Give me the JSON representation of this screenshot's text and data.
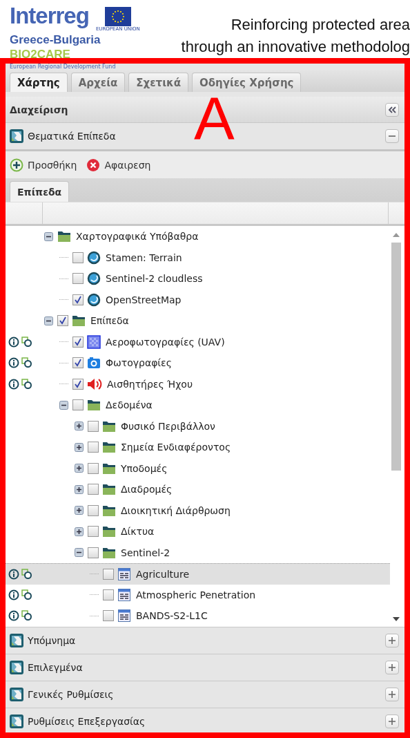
{
  "header": {
    "logo_text": "Interreg",
    "flag_caption": "EUROPEAN UNION",
    "region": "Greece-Bulgaria",
    "project": "BIO2CARE",
    "fund": "European Regional Development Fund",
    "title_lines": [
      "Reinforcing protected area",
      "through an innovative methodolog"
    ]
  },
  "annotation": {
    "label": "A"
  },
  "tabs": [
    {
      "label": "Χάρτης",
      "selected": true
    },
    {
      "label": "Αρχεία",
      "selected": false
    },
    {
      "label": "Σχετικά",
      "selected": false
    },
    {
      "label": "Οδηγίες Χρήσης",
      "selected": false
    }
  ],
  "panel": {
    "title": "Διαχείριση"
  },
  "sections": [
    {
      "title": "Θεματικά Επίπεδα",
      "expanded": true
    },
    {
      "title": "Υπόμνημα",
      "expanded": false
    },
    {
      "title": "Επιλεγμένα",
      "expanded": false
    },
    {
      "title": "Γενικές Ρυθμίσεις",
      "expanded": false
    },
    {
      "title": "Ρυθμίσεις Επεξεργασίας",
      "expanded": false
    }
  ],
  "toolbar": [
    {
      "kind": "add",
      "label": "Προσθήκη"
    },
    {
      "kind": "remove",
      "label": "Αφαιρεση"
    }
  ],
  "subtabs": [
    {
      "label": "Επίπεδα",
      "selected": true
    }
  ],
  "tree": [
    {
      "kind": "folder",
      "label": "Χαρτογραφικά Υπόβαθρα",
      "expanded": true,
      "tools": false,
      "selected": false,
      "children": [
        {
          "kind": "map",
          "label": "Stamen: Terrain",
          "checked": false,
          "tools": false,
          "selected": false
        },
        {
          "kind": "map",
          "label": "Sentinel-2 cloudless",
          "checked": false,
          "tools": false,
          "selected": false
        },
        {
          "kind": "map",
          "label": "OpenStreetMap",
          "checked": true,
          "tools": false,
          "selected": false
        }
      ]
    },
    {
      "kind": "folder",
      "label": "Επίπεδα",
      "expanded": true,
      "checked": true,
      "tools": false,
      "selected": false,
      "children": [
        {
          "kind": "raster",
          "label": "Αεροφωτογραφίες (UAV)",
          "checked": true,
          "tools": true,
          "selected": false
        },
        {
          "kind": "camera",
          "label": "Φωτογραφίες",
          "checked": true,
          "tools": true,
          "selected": false
        },
        {
          "kind": "sound",
          "label": "Αισθητήρες Ήχου",
          "checked": true,
          "tools": true,
          "selected": false
        },
        {
          "kind": "folder",
          "label": "Δεδομένα",
          "expanded": true,
          "checked": false,
          "tools": false,
          "selected": false,
          "children": [
            {
              "kind": "folder",
              "label": "Φυσικό Περιβάλλον",
              "expanded": false,
              "checked": false,
              "tools": false,
              "selected": false
            },
            {
              "kind": "folder",
              "label": "Σημεία Ενδιαφέροντος",
              "expanded": false,
              "checked": false,
              "tools": false,
              "selected": false
            },
            {
              "kind": "folder",
              "label": "Υποδομές",
              "expanded": false,
              "checked": false,
              "tools": false,
              "selected": false
            },
            {
              "kind": "folder",
              "label": "Διαδρομές",
              "expanded": false,
              "checked": false,
              "tools": false,
              "selected": false
            },
            {
              "kind": "folder",
              "label": "Διοικητική Διάρθρωση",
              "expanded": false,
              "checked": false,
              "tools": false,
              "selected": false
            },
            {
              "kind": "folder",
              "label": "Δίκτυα",
              "expanded": false,
              "checked": false,
              "tools": false,
              "selected": false
            },
            {
              "kind": "folder",
              "label": "Sentinel-2",
              "expanded": true,
              "checked": false,
              "tools": false,
              "selected": false,
              "children": [
                {
                  "kind": "layer",
                  "label": "Agriculture",
                  "checked": false,
                  "tools": true,
                  "selected": true
                },
                {
                  "kind": "layer",
                  "label": "Atmospheric Penetration",
                  "checked": false,
                  "tools": true,
                  "selected": false
                },
                {
                  "kind": "layer",
                  "label": "BANDS-S2-L1C",
                  "checked": false,
                  "tools": true,
                  "selected": false
                }
              ]
            }
          ]
        }
      ]
    }
  ]
}
